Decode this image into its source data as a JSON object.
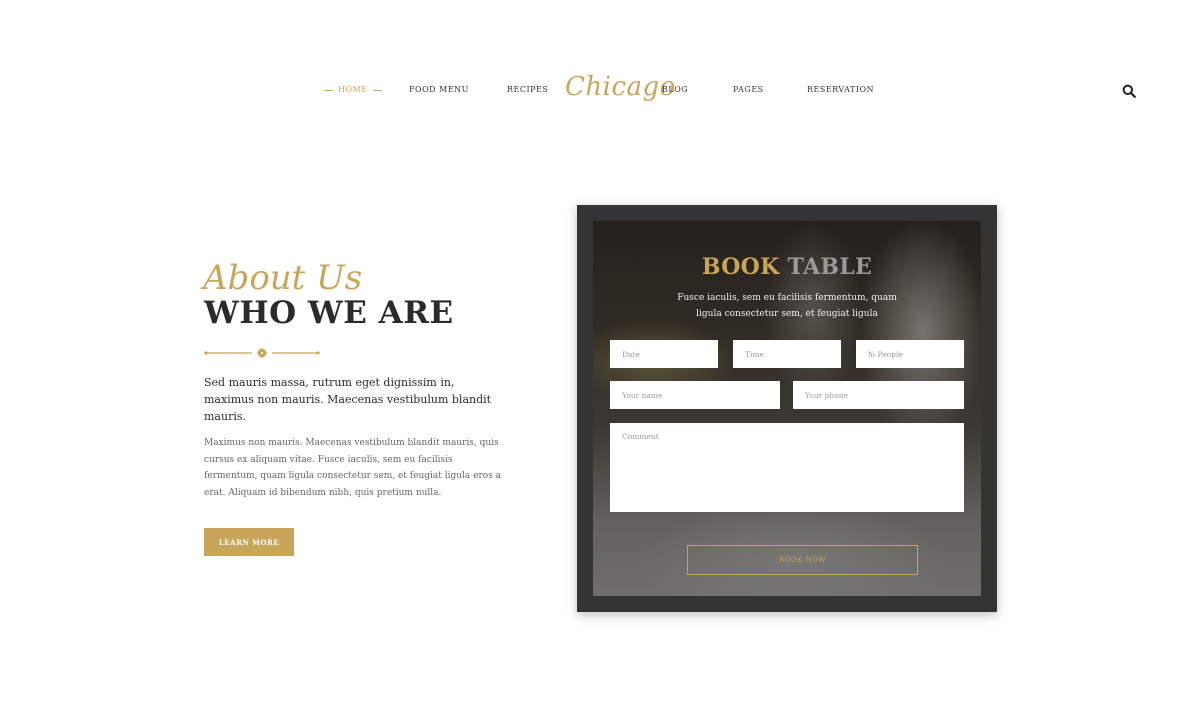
{
  "nav": {
    "items": [
      {
        "label": "HOME",
        "active": true
      },
      {
        "label": "FOOD MENU"
      },
      {
        "label": "RECIPES"
      },
      {
        "label": "BLOG"
      },
      {
        "label": "PAGES"
      },
      {
        "label": "RESERVATION"
      }
    ],
    "brand": "Chicago",
    "search_icon": "search-icon"
  },
  "about": {
    "script_title": "About Us",
    "title": "WHO WE ARE",
    "divider_icon": "flower-ornament-icon",
    "lead": "Sed mauris massa, rutrum eget dignissim in, maximus non mauris. Maecenas vestibulum blandit mauris.",
    "body": "Maximus non mauris. Maecenas vestibulum blandit mauris, quis cursus ex aliquam vitae. Fusce iaculis, sem eu facilisis fermentum, quam ligula consectetur sem, et feugiat ligula eros a erat. Aliquam id bibendum nibh, quis pretium nulla.",
    "button_label": "LEARN MORE"
  },
  "booking": {
    "title_part1": "BOOK",
    "title_part2": "TABLE",
    "subtitle": "Fusce iaculis, sem eu facilisis fermentum, quam ligula consectetur sem, et feugiat ligula",
    "date_placeholder": "Date",
    "time_placeholder": "Time",
    "people_placeholder": "№ People",
    "name_placeholder": "Your name",
    "phone_placeholder": "Your phone",
    "comment_placeholder": "Comment",
    "button_label": "BOOK NOW"
  },
  "colors": {
    "accent": "#c9a55a",
    "dark": "#2b2b2b",
    "card_frame": "#343434"
  }
}
